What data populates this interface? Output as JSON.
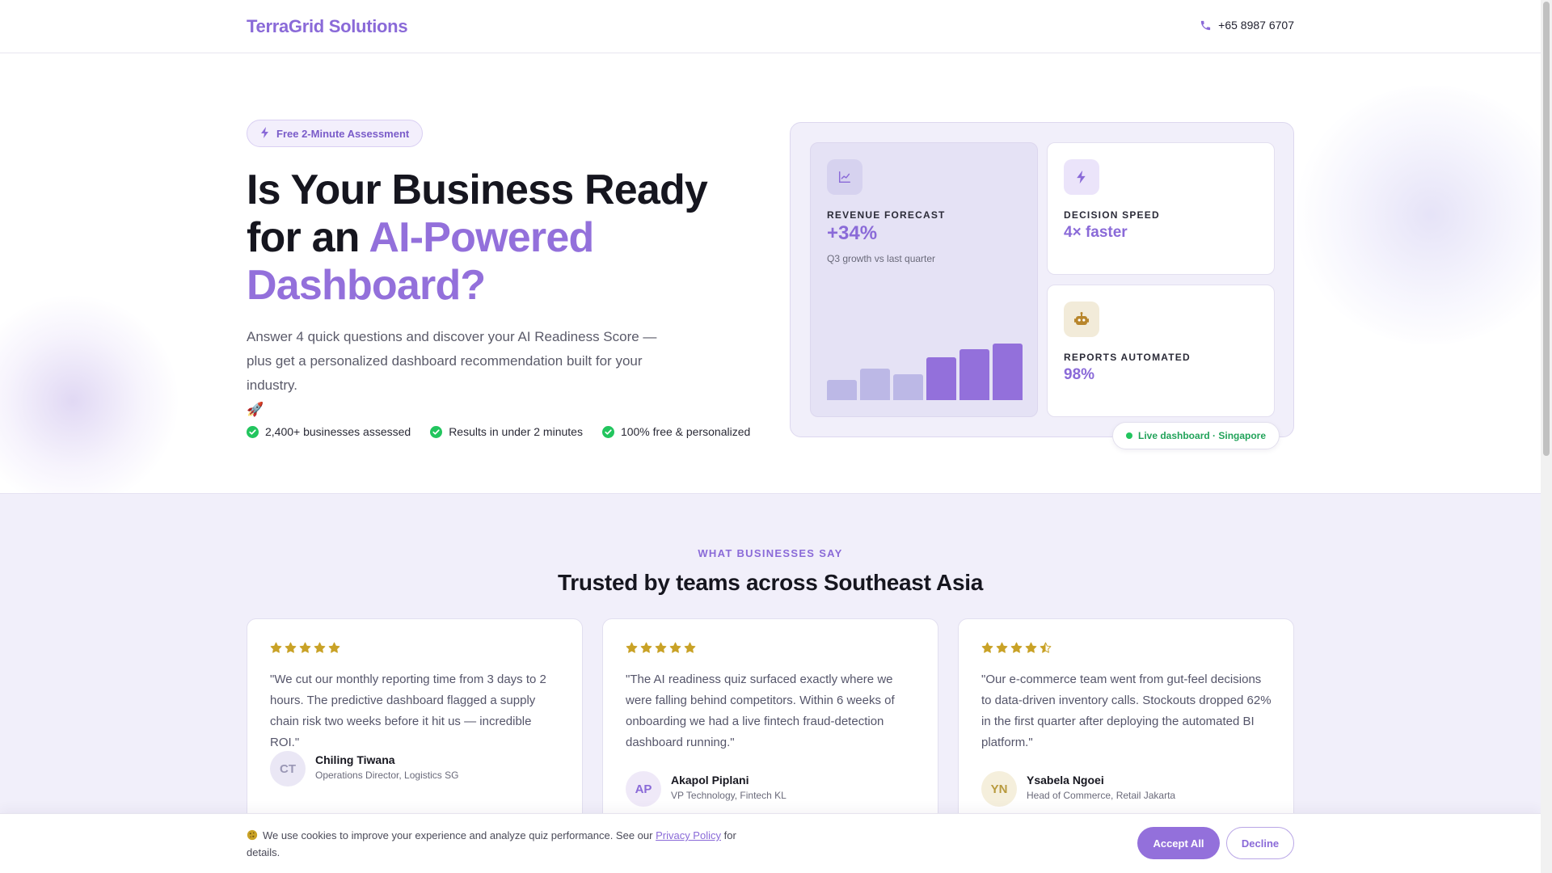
{
  "header": {
    "logo": "TerraGrid Solutions",
    "phone": "+65 8987 6707"
  },
  "hero": {
    "badge": "Free 2-Minute Assessment",
    "headline_part1": "Is Your Business Ready for an ",
    "headline_accent": "AI-Powered Dashboard?",
    "lead": "Answer 4 quick questions and discover your AI Readiness Score — plus get a personalized dashboard recommendation built for your industry.",
    "lead_emoji": "🚀",
    "checks": [
      "2,400+ businesses assessed",
      "Results in under 2 minutes",
      "100% free & personalized"
    ]
  },
  "dashboard": {
    "revenue": {
      "label": "REVENUE FORECAST",
      "value": "+34%",
      "sub": "Q3 growth vs last quarter",
      "icon": "chart-line-icon"
    },
    "speed": {
      "label": "DECISION SPEED",
      "value": "4× faster",
      "icon": "bolt-icon"
    },
    "reports": {
      "label": "REPORTS AUTOMATED",
      "value": "98%",
      "icon": "robot-icon"
    },
    "live_badge": "Live dashboard · Singapore",
    "bar_levels": [
      0.35,
      0.55,
      0.45,
      0.75,
      0.9,
      1.0
    ],
    "bar_colors": [
      "#bcb8e6",
      "#bcb8e6",
      "#bcb8e6",
      "#9370db",
      "#9370db",
      "#9370db"
    ]
  },
  "testimonials": {
    "eyebrow": "WHAT BUSINESSES SAY",
    "title": "Trusted by teams across Southeast Asia",
    "items": [
      {
        "rating": 5,
        "quote": "\"We cut our monthly reporting time from 3 days to 2 hours. The predictive dashboard flagged a supply chain risk two weeks before it hit us — incredible ROI.\"",
        "initials": "CT",
        "name": "Chiling Tiwana",
        "role": "Operations Director, Logistics SG",
        "avatar_bg": "#eae7f5",
        "avatar_color": "#9a97b5"
      },
      {
        "rating": 5,
        "quote": "\"The AI readiness quiz surfaced exactly where we were falling behind competitors. Within 6 weeks of onboarding we had a live fintech fraud-detection dashboard running.\"",
        "initials": "AP",
        "name": "Akapol Piplani",
        "role": "VP Technology, Fintech KL",
        "avatar_bg": "#efe9f8",
        "avatar_color": "#8a6ad8"
      },
      {
        "rating": 4.5,
        "quote": "\"Our e-commerce team went from gut-feel decisions to data-driven inventory calls. Stockouts dropped 62% in the first quarter after deploying the automated BI platform.\"",
        "initials": "YN",
        "name": "Ysabela Ngoei",
        "role": "Head of Commerce, Retail Jakarta",
        "avatar_bg": "#f5efdc",
        "avatar_color": "#b89a3e"
      }
    ]
  },
  "cookie": {
    "icon": "cookie-icon",
    "text_before": "We use cookies to improve your experience and analyze quiz performance. See our ",
    "link": "Privacy Policy",
    "text_after": " for details.",
    "accept": "Accept All",
    "decline": "Decline"
  },
  "colors": {
    "accent": "#9370db",
    "star": "#c9a227",
    "success": "#22c55e"
  }
}
